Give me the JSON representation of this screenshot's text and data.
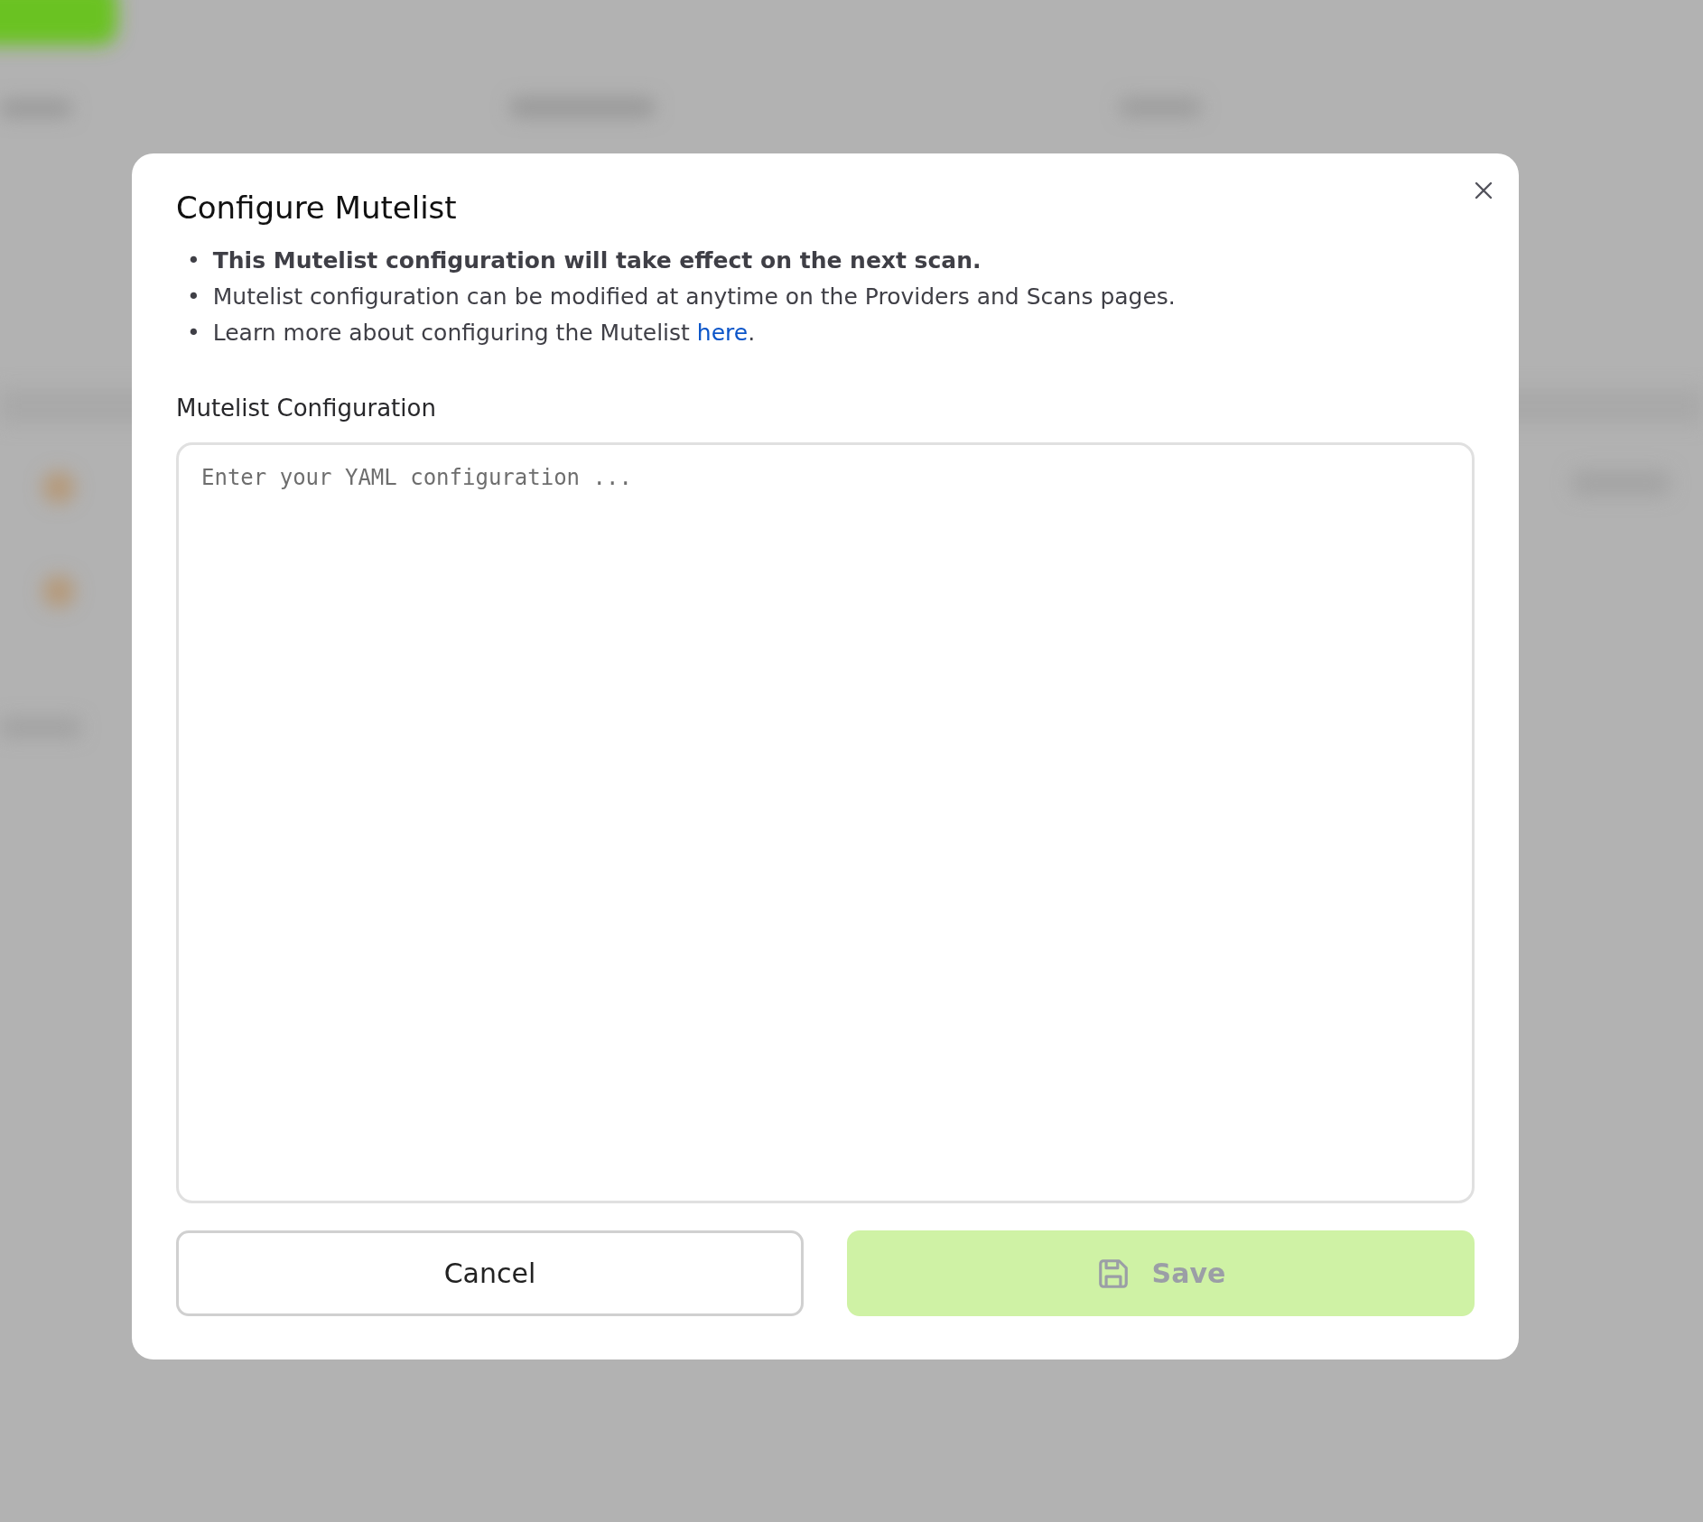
{
  "dialog": {
    "title": "Configure Mutelist",
    "notes": [
      {
        "bullet": "•",
        "text": "**This Mutelist configuration will take effect on the next scan.**"
      },
      {
        "bullet": "•",
        "text": "Mutelist configuration can be modified at anytime on the Providers and Scans pages."
      },
      {
        "bullet": "•",
        "text": "Learn more about configuring the Mutelist "
      }
    ],
    "note_link": {
      "text": "here",
      "after": "."
    },
    "field": {
      "label": "Mutelist Configuration",
      "placeholder": "Enter your YAML configuration ..."
    },
    "buttons": [
      {
        "kind": "secondary",
        "label": "Cancel",
        "disabled": false
      },
      {
        "kind": "primary",
        "label": "Save",
        "disabled": true
      }
    ]
  }
}
